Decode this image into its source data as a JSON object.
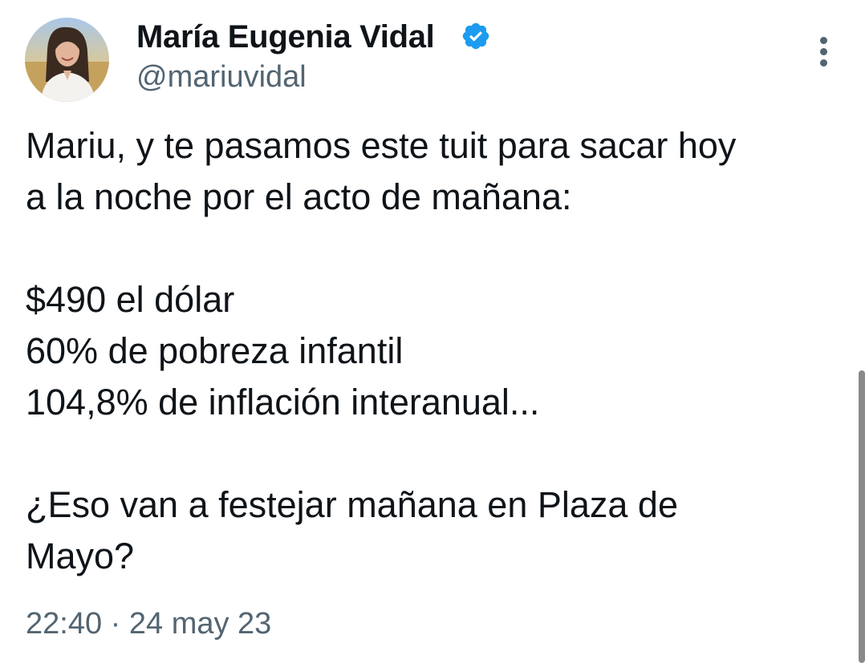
{
  "author": {
    "display_name": "María Eugenia Vidal",
    "handle": "@mariuvidal",
    "verified": true,
    "verified_color": "#1d9bf0"
  },
  "tweet": {
    "lines": [
      "Mariu, y te pasamos este tuit para sacar hoy",
      "a la noche por el acto de mañana:",
      "",
      "$490 el dólar",
      "60% de pobreza infantil",
      "104,8% de inflación interanual...",
      "",
      "¿Eso van a festejar mañana en Plaza de",
      "Mayo?"
    ]
  },
  "meta": {
    "time": "22:40",
    "separator": "·",
    "date": "24 may 23"
  },
  "icons": {
    "more": "more-vertical-icon",
    "verified": "verified-badge-icon"
  },
  "colors": {
    "text": "#0f1419",
    "secondary": "#536471",
    "background": "#ffffff"
  }
}
